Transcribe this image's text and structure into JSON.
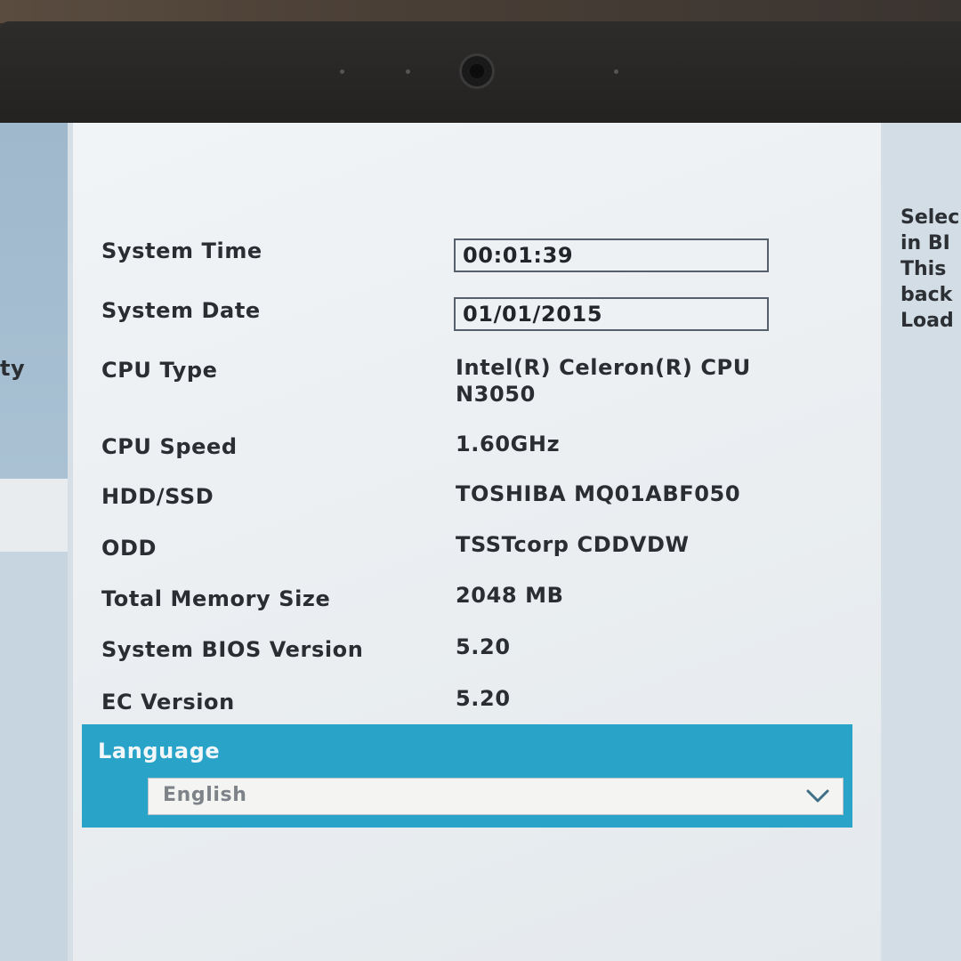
{
  "sidebar": {
    "partial_item": "ty"
  },
  "help": {
    "text": "Selec\nin BI\nThis \nback\nLoad"
  },
  "info_rows": [
    {
      "label": "System Time",
      "value": "00:01:39"
    },
    {
      "label": "System Date",
      "value": "01/01/2015"
    },
    {
      "label": "CPU Type",
      "value_line1": "Intel(R) Celeron(R) CPU",
      "value_line2": "N3050"
    },
    {
      "label": "CPU Speed",
      "value": "1.60GHz"
    },
    {
      "label": "HDD/SSD",
      "value": "TOSHIBA MQ01ABF050"
    },
    {
      "label": "ODD",
      "value": "TSSTcorp CDDVDW"
    },
    {
      "label": "Total Memory Size",
      "value": "2048 MB"
    },
    {
      "label": "System BIOS Version",
      "value": "5.20"
    },
    {
      "label": "EC Version",
      "value": "5.20"
    }
  ],
  "language": {
    "label": "Language",
    "selected": "English",
    "icon": "chevron-down-icon"
  },
  "colors": {
    "accent": "#2aa3c9",
    "panel": "#eef1f3",
    "text": "#2a2e33"
  }
}
